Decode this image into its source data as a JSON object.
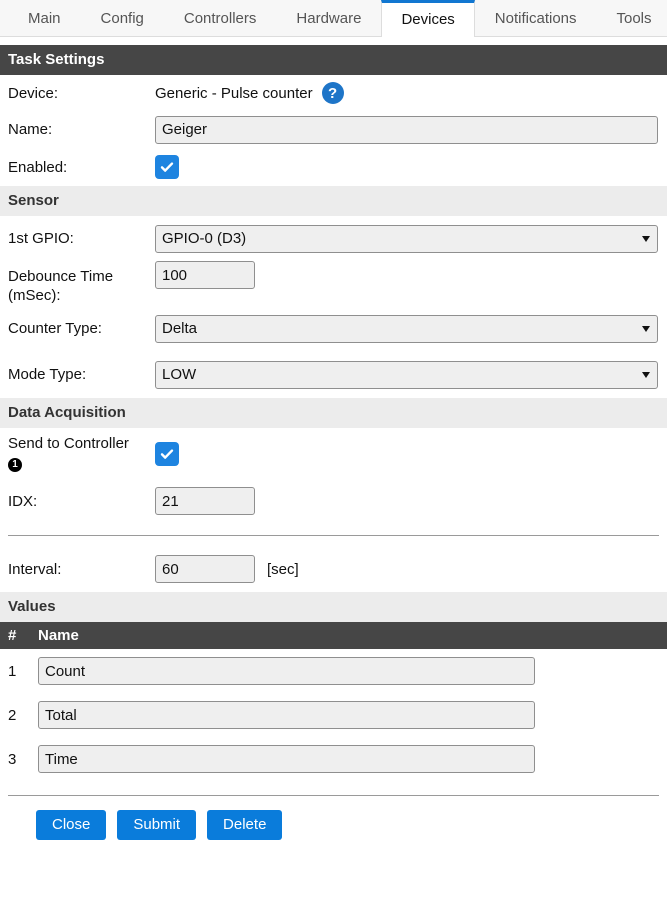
{
  "nav": {
    "tabs": [
      {
        "label": "Main",
        "active": false
      },
      {
        "label": "Config",
        "active": false
      },
      {
        "label": "Controllers",
        "active": false
      },
      {
        "label": "Hardware",
        "active": false
      },
      {
        "label": "Devices",
        "active": true
      },
      {
        "label": "Notifications",
        "active": false
      },
      {
        "label": "Tools",
        "active": false
      }
    ]
  },
  "header": {
    "title": "Task Settings"
  },
  "task": {
    "device_label": "Device:",
    "device_value": "Generic - Pulse counter",
    "help_icon": "?",
    "name_label": "Name:",
    "name_value": "Geiger",
    "enabled_label": "Enabled:",
    "enabled_checked": true
  },
  "sensor": {
    "title": "Sensor",
    "gpio_label": "1st GPIO:",
    "gpio_value": "GPIO-0 (D3)",
    "debounce_label": "Debounce Time (mSec):",
    "debounce_label_line1": "Debounce Time",
    "debounce_label_line2": "(mSec):",
    "debounce_value": "100",
    "counter_type_label": "Counter Type:",
    "counter_type_value": "Delta",
    "mode_type_label": "Mode Type:",
    "mode_type_value": "LOW"
  },
  "data_acquisition": {
    "title": "Data Acquisition",
    "send_to_controller_label": "Send to Controller",
    "controller_number": "1",
    "send_to_controller_checked": true,
    "idx_label": "IDX:",
    "idx_value": "21",
    "interval_label": "Interval:",
    "interval_value": "60",
    "interval_unit": "[sec]"
  },
  "values": {
    "title": "Values",
    "columns": [
      "#",
      "Name"
    ],
    "rows": [
      {
        "num": "1",
        "name": "Count"
      },
      {
        "num": "2",
        "name": "Total"
      },
      {
        "num": "3",
        "name": "Time"
      }
    ]
  },
  "footer": {
    "close_label": "Close",
    "submit_label": "Submit",
    "delete_label": "Delete"
  },
  "colors": {
    "accent_blue": "#0a7cdb",
    "active_tab_border": "#1177d1",
    "checkbox_blue": "#1e84e0",
    "dark_bar": "#464646",
    "subhead_gray": "#ececec",
    "input_gray": "#efefef"
  }
}
